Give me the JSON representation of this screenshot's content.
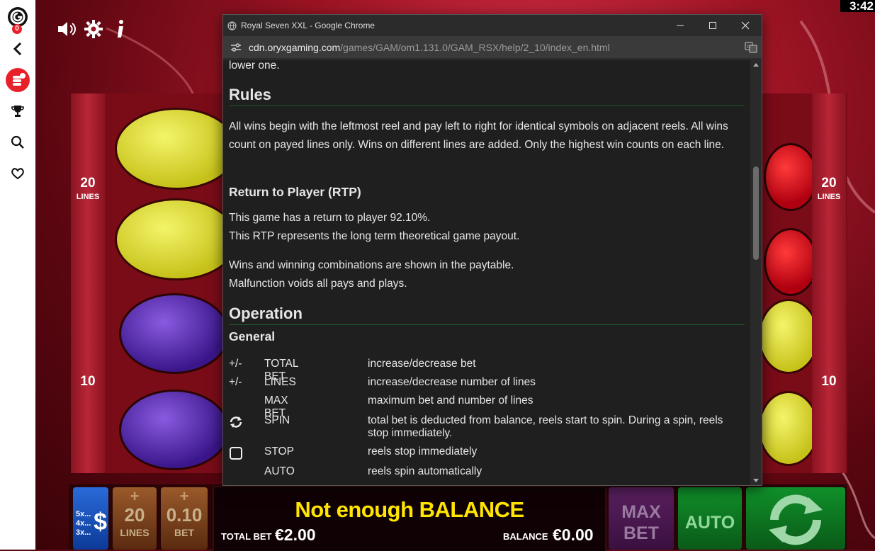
{
  "clock": "3:42",
  "sidebar": {
    "badge_count": "0",
    "icons": [
      "brand-logo-icon",
      "back-chevron-icon",
      "coins-icon",
      "trophy-icon",
      "search-icon",
      "heart-icon"
    ]
  },
  "game_top": {
    "icons": [
      "speaker-icon",
      "gear-icon",
      "info-icon"
    ]
  },
  "lines_left": {
    "top_value": "20",
    "top_label": "LINES",
    "mid_value": "10"
  },
  "lines_right": {
    "top_value": "20",
    "top_label": "LINES",
    "mid_value": "10"
  },
  "browser": {
    "title": "Royal Seven XXL - Google Chrome",
    "url_host": "cdn.oryxgaming.com",
    "url_path": "/games/GAM/om1.131.0/GAM_RSX/help/2_10/index_en.html"
  },
  "help": {
    "top_fragment": "lower one.",
    "rules_heading": "Rules",
    "rules_text": "All wins begin with the leftmost reel and pay left to right for identical symbols on adjacent reels. All wins count on payed lines only. Wins on different lines are added. Only the highest win counts on each line.",
    "rtp_heading": "Return to Player (RTP)",
    "rtp_line1": "This game has a return to player 92.10%.",
    "rtp_line2": "This RTP represents the long term theoretical game payout.",
    "wins_line1": "Wins and winning combinations are shown in the paytable.",
    "wins_line2": "Malfunction voids all pays and plays.",
    "operation_heading": "Operation",
    "general_heading": "General",
    "controls": [
      {
        "key": "+/-",
        "name": "TOTAL BET",
        "desc": "increase/decrease bet"
      },
      {
        "key": "+/-",
        "name": "LINES",
        "desc": "increase/decrease number of lines"
      },
      {
        "key": "",
        "name": "MAX BET",
        "desc": "maximum bet and number of lines"
      },
      {
        "key": "",
        "name": "SPIN",
        "desc": "total bet is deducted from balance, reels start to spin. During a spin, reels stop immediately."
      },
      {
        "key": "",
        "name": "STOP",
        "desc": "reels stop immediately"
      },
      {
        "key": "",
        "name": "AUTO",
        "desc": "reels spin automatically"
      }
    ]
  },
  "bottom_bar": {
    "paytable_lines": [
      "5x...",
      "4x...",
      "3x..."
    ],
    "paytable_symbol": "$",
    "lines_value": "20",
    "lines_label": "LINES",
    "bet_value": "0.10",
    "bet_label": "BET",
    "message": "Not enough BALANCE",
    "total_bet_label": "TOTAL BET",
    "total_bet_value": "€2.00",
    "balance_label": "BALANCE",
    "balance_value": "€0.00",
    "max_bet_line1": "MAX",
    "max_bet_line2": "BET",
    "auto_label": "AUTO"
  },
  "colors": {
    "message": "#ffe500",
    "link_green": "#1e5a2a",
    "auto_green": "#0c7a22",
    "maxbet_purple": "#4a1a4e"
  }
}
